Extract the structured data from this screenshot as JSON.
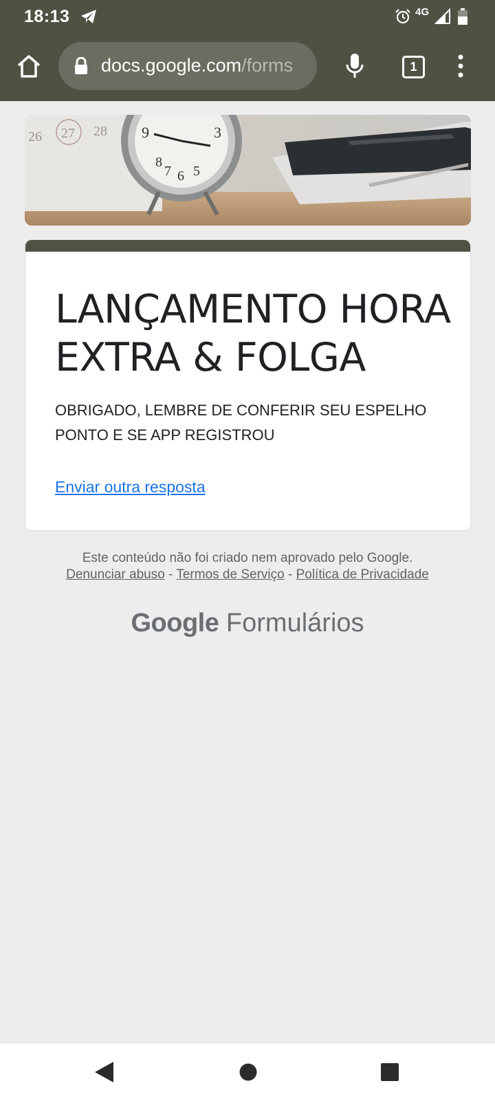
{
  "status_bar": {
    "time": "18:13",
    "network": "4G",
    "icons": [
      "telegram-icon",
      "alarm-icon",
      "signal-icon",
      "battery-icon"
    ]
  },
  "browser": {
    "url_host": "docs.google.com",
    "url_path": "/forms",
    "tab_count": "1",
    "icons": [
      "home-icon",
      "lock-icon",
      "mic-icon",
      "tabs-icon",
      "more-vert-icon"
    ]
  },
  "form": {
    "title": "LANÇAMENTO HORA EXTRA & FOLGA",
    "confirmation_message": "OBRIGADO, LEMBRE DE CONFERIR SEU ESPELHO PONTO E SE APP REGISTROU",
    "resubmit_link": "Enviar outra resposta",
    "theme_color": "#4f5143"
  },
  "footer": {
    "disclaimer": "Este conteúdo não foi criado nem aprovado pelo Google.",
    "report_abuse": "Denunciar abuso",
    "separator": " - ",
    "terms": "Termos de Serviço",
    "privacy": "Política de Privacidade",
    "brand_google": "Google",
    "brand_product": "Formulários"
  },
  "nav_bar": {
    "icons": [
      "back-icon",
      "home-circle-icon",
      "recents-icon"
    ]
  }
}
